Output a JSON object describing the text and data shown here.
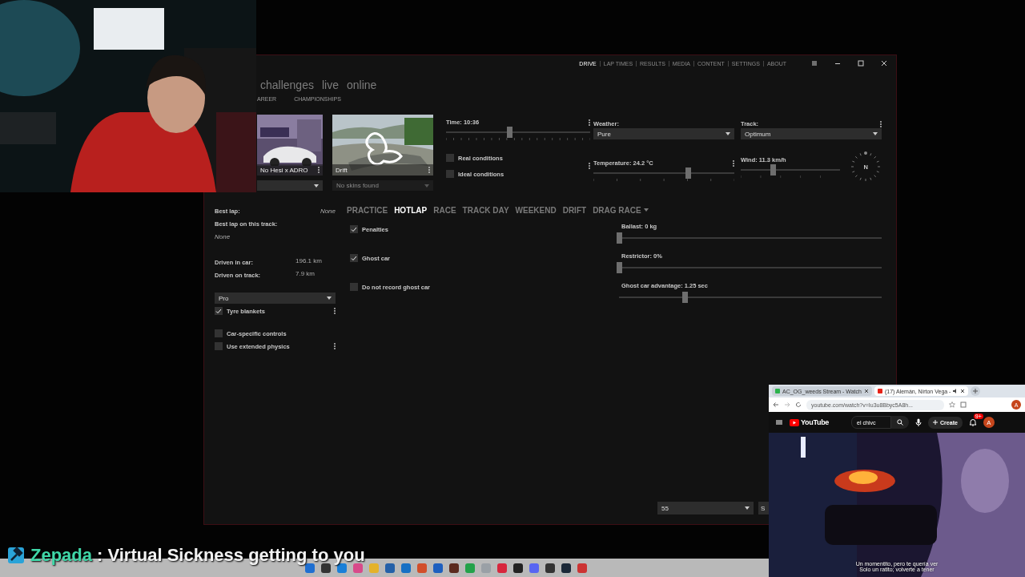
{
  "app_window": {
    "nav": [
      {
        "label": "DRIVE",
        "selected": true
      },
      {
        "label": "LAP TIMES",
        "selected": false
      },
      {
        "label": "RESULTS",
        "selected": false
      },
      {
        "label": "MEDIA",
        "selected": false
      },
      {
        "label": "CONTENT",
        "selected": false
      },
      {
        "label": "SETTINGS",
        "selected": false
      },
      {
        "label": "ABOUT",
        "selected": false
      }
    ],
    "sections": [
      "challenges",
      "live",
      "online"
    ],
    "sub_tabs": [
      "AREER",
      "CHAMPIONSHIPS"
    ],
    "car": {
      "name": "No Hesi x ADRO"
    },
    "track": {
      "name": "Drift",
      "skin_placeholder": "No skins found"
    },
    "time": {
      "label": "Time: 10:36",
      "level": 0.44
    },
    "conditions": [
      {
        "label": "Real conditions",
        "checked": false
      },
      {
        "label": "Ideal conditions",
        "checked": false
      }
    ],
    "weather": {
      "label": "Weather:",
      "value": "Pure"
    },
    "temperature": {
      "label": "Temperature: 24.2 °C",
      "level": 0.67
    },
    "track_state": {
      "label": "Track:",
      "value": "Optimum"
    },
    "wind": {
      "label": "Wind: 11.3 km/h",
      "level": 0.32,
      "direction": "N"
    },
    "stats": [
      {
        "label": "Best lap:",
        "value": "None",
        "kind": "inline"
      },
      {
        "label": "Best lap on this track:",
        "value": "None",
        "kind": "below"
      },
      {
        "label": "Driven in car:",
        "value": "196.1 km",
        "kind": "column"
      },
      {
        "label": "Driven on track:",
        "value": "7.9 km",
        "kind": "column"
      }
    ],
    "assists": {
      "preset": "Pro",
      "options": [
        {
          "label": "Tyre blankets",
          "checked": true,
          "menu": true
        },
        {
          "label": "Car-specific controls",
          "checked": false,
          "menu": false
        },
        {
          "label": "Use extended physics",
          "checked": false,
          "menu": true
        }
      ]
    },
    "modes": [
      {
        "label": "PRACTICE",
        "selected": false,
        "dropdown": false
      },
      {
        "label": "HOTLAP",
        "selected": true,
        "dropdown": false
      },
      {
        "label": "RACE",
        "selected": false,
        "dropdown": false
      },
      {
        "label": "TRACK DAY",
        "selected": false,
        "dropdown": false
      },
      {
        "label": "WEEKEND",
        "selected": false,
        "dropdown": false
      },
      {
        "label": "DRIFT",
        "selected": false,
        "dropdown": false
      },
      {
        "label": "DRAG RACE",
        "selected": false,
        "dropdown": true
      }
    ],
    "mode_options": [
      {
        "label": "Penalties",
        "checked": true
      },
      {
        "label": "Ghost car",
        "checked": true
      },
      {
        "label": "Do not record ghost car",
        "checked": false
      }
    ],
    "sliders": [
      {
        "label": "Ballast: 0 kg",
        "level": 0
      },
      {
        "label": "Restrictor: 0%",
        "level": 0
      },
      {
        "label": "Ghost car advantage: 1.25 sec",
        "level": 0.25
      }
    ],
    "footer": {
      "select": "55",
      "button": "S"
    }
  },
  "browser": {
    "tabs": [
      {
        "title": "AC_OG_weeds Stream - Watch",
        "selected": false,
        "audio": false
      },
      {
        "title": "(17) Alemán, Nirton Vega -",
        "selected": true,
        "audio": true
      }
    ],
    "url": "youtube.com/watch?v=Iu3u8Bbyc5A8h...",
    "profile": "A",
    "site": {
      "logo": "YouTube",
      "search": "el chivc",
      "create": "Create",
      "notifications": "9+",
      "avatar": "A"
    },
    "subtitles": [
      "Un momentito, pero te quería ver",
      "Solo un ratito; volverte a tener"
    ]
  },
  "chat": {
    "user": "Zepada",
    "message": ": Virtual Sickness getting to you"
  }
}
